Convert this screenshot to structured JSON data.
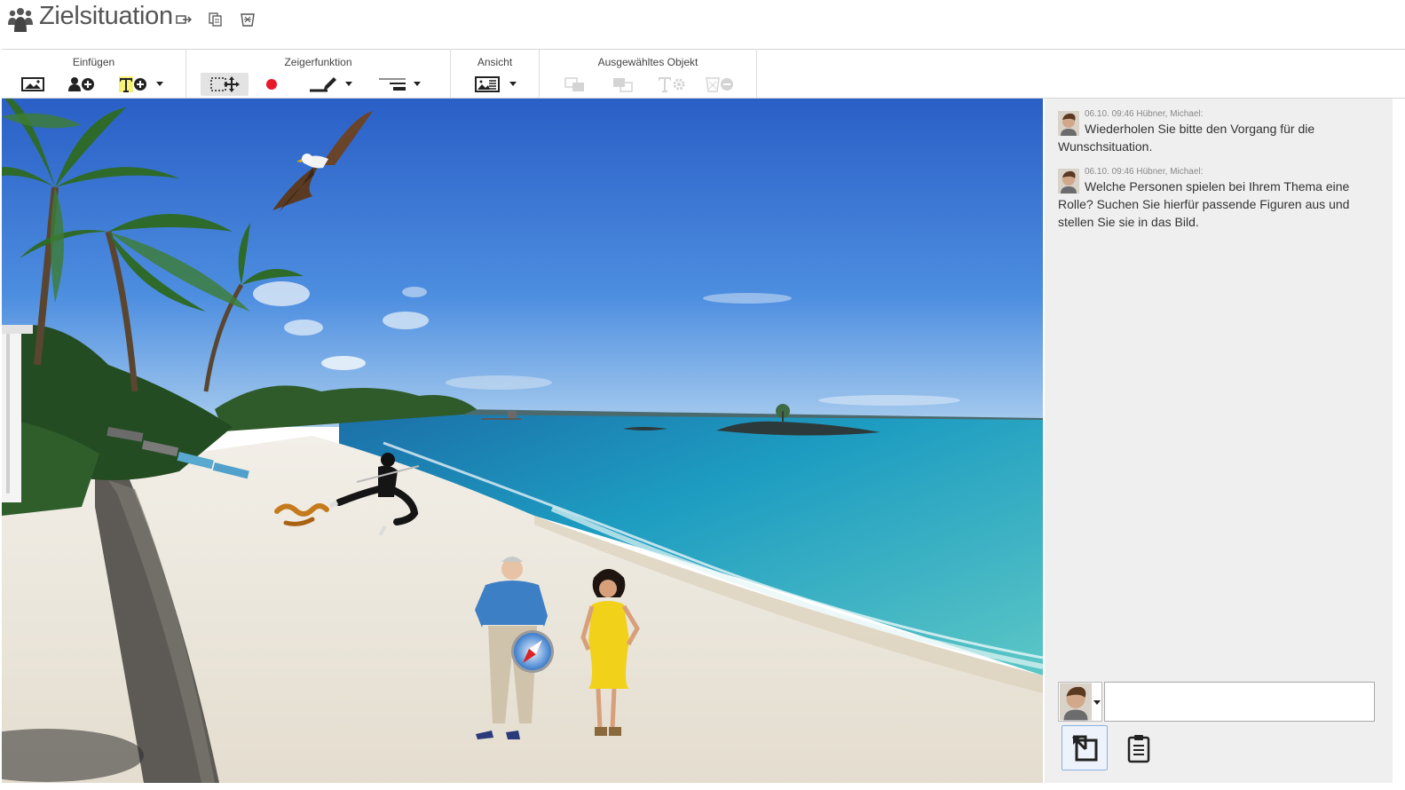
{
  "app": {
    "title": "Zielsituation",
    "title_icon": "people-group-icon",
    "title_actions": [
      "export-icon",
      "copy-icon",
      "trash-icon"
    ]
  },
  "toolbar": {
    "groups": [
      {
        "label": "Einfügen",
        "buttons": [
          "insert-background-icon",
          "add-person-icon",
          "add-text-icon"
        ]
      },
      {
        "label": "Zeigerfunktion",
        "buttons": [
          "select-move-icon",
          "record-dot-icon",
          "pen-icon",
          "line-weight-icon"
        ]
      },
      {
        "label": "Ansicht",
        "buttons": [
          "view-card-icon"
        ]
      },
      {
        "label": "Ausgewähltes Objekt",
        "buttons": [
          "arrange-front-icon",
          "arrange-back-icon",
          "text-settings-icon",
          "delete-object-icon"
        ],
        "disabled": true
      }
    ]
  },
  "chat": {
    "messages": [
      {
        "meta": "06.10. 09:46 Hübner, Michael:",
        "text": "Wiederholen Sie bitte den Vorgang für die Wunschsituation."
      },
      {
        "meta": "06.10. 09:46 Hübner, Michael:",
        "text": "Welche Personen spielen bei Ihrem Thema eine Rolle? Suchen Sie hierfür passende Figuren aus und stellen Sie sie in das Bild."
      }
    ],
    "input_value": "",
    "buttons": [
      "reply-icon",
      "clipboard-icon"
    ]
  },
  "colors": {
    "sky_top": "#2f66c8",
    "sky_bottom": "#9cc3ea",
    "sea": "#1d9bc0",
    "sand": "#ece7dc",
    "panel_bg": "#efefef",
    "dress": "#f2d11a",
    "shirt": "#3d7fc4"
  }
}
